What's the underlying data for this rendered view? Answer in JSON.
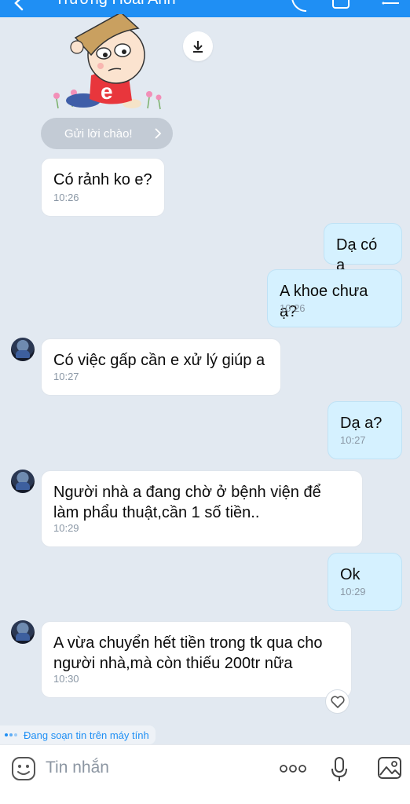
{
  "header": {
    "title": "Trương Hoài Anh"
  },
  "sticker": {
    "letter": "e"
  },
  "greeting": {
    "label": "Gửi lời chào!"
  },
  "messages": [
    {
      "dir": "in",
      "text": "Có rảnh ko e?",
      "time": "10:26"
    },
    {
      "dir": "out",
      "text": "Dạ có a",
      "time": ""
    },
    {
      "dir": "out",
      "text": "A khoe chưa ạ?",
      "time": "10:26"
    },
    {
      "dir": "in",
      "text": "Có việc gấp cần e xử lý giúp a",
      "time": "10:27"
    },
    {
      "dir": "out",
      "text": "Dạ a?",
      "time": "10:27"
    },
    {
      "dir": "in",
      "text": "Người nhà a đang chờ ở bệnh viện để làm phẩu thuật,cần 1 số tiền..",
      "time": "10:29"
    },
    {
      "dir": "out",
      "text": "Ok",
      "time": "10:29"
    },
    {
      "dir": "in",
      "text": "A vừa chuyển hết tiền trong tk qua cho người nhà,mà còn thiếu 200tr nữa",
      "time": "10:30"
    }
  ],
  "typing_indicator": {
    "text": "Đang soạn tin trên máy tính"
  },
  "composer": {
    "placeholder": "Tin nhắn"
  },
  "colors": {
    "accent": "#1f8ff4",
    "incoming_bg": "#ffffff",
    "outgoing_bg": "#d5f1ff",
    "chat_bg": "#e2e9f1"
  },
  "icons": [
    "back-arrow-icon",
    "phone-icon",
    "video-icon",
    "menu-icon",
    "download-icon",
    "chevron-right-icon",
    "heart-icon",
    "emoji-icon",
    "more-icon",
    "microphone-icon",
    "image-icon"
  ]
}
